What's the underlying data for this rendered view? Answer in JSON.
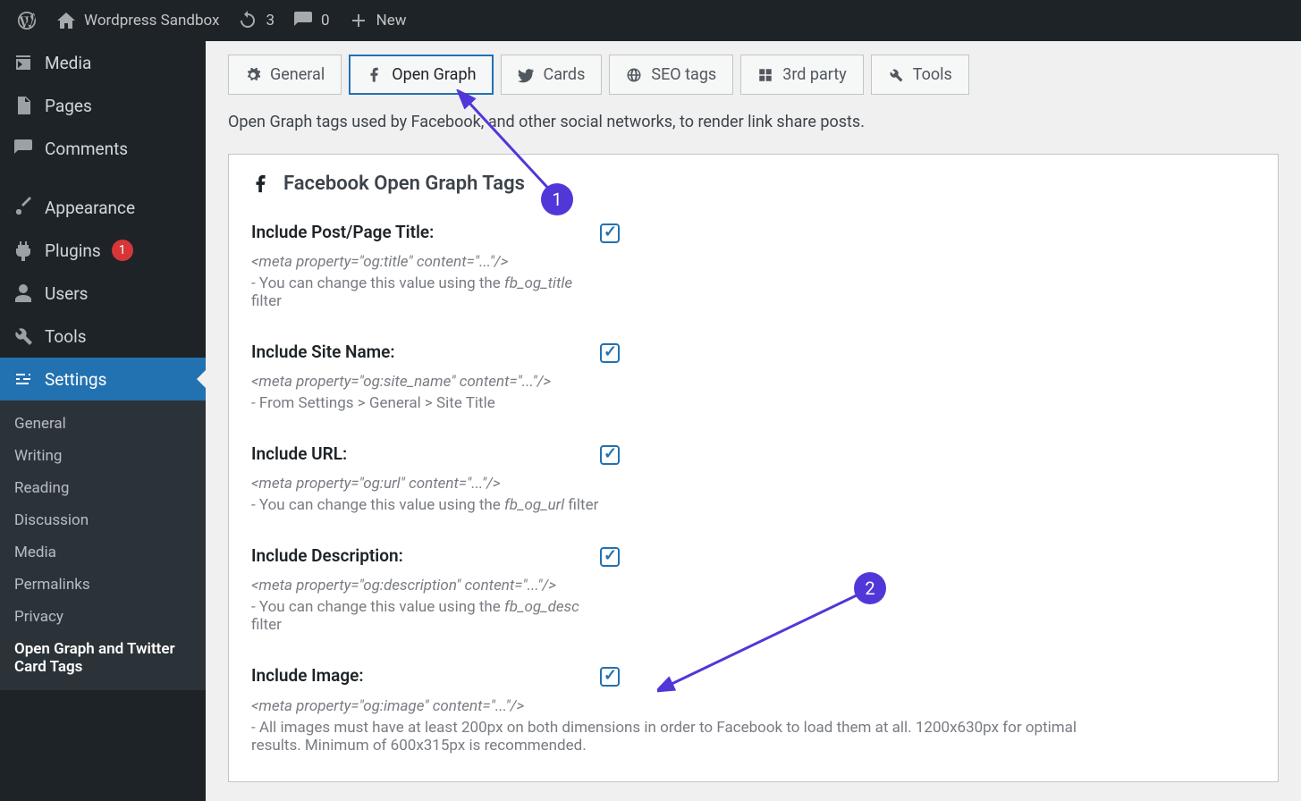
{
  "adminbar": {
    "site_name": "Wordpress Sandbox",
    "updates_count": "3",
    "comments_count": "0",
    "new_label": "New"
  },
  "sidebar": {
    "media": "Media",
    "pages": "Pages",
    "comments": "Comments",
    "appearance": "Appearance",
    "plugins": "Plugins",
    "plugins_badge": "1",
    "users": "Users",
    "tools": "Tools",
    "settings": "Settings",
    "sub": {
      "general": "General",
      "writing": "Writing",
      "reading": "Reading",
      "discussion": "Discussion",
      "media": "Media",
      "permalinks": "Permalinks",
      "privacy": "Privacy",
      "ogtags": "Open Graph and Twitter Card Tags"
    }
  },
  "tabs": {
    "general": "General",
    "open_graph": "Open Graph",
    "cards": "Cards",
    "seo": "SEO tags",
    "third_party": "3rd party",
    "tools": "Tools"
  },
  "intro": "Open Graph tags used by Facebook, and other social networks, to render link share posts.",
  "panel_title": "Facebook Open Graph Tags",
  "settings": {
    "title": {
      "label": "Include Post/Page Title:",
      "meta": "<meta property=\"og:title\" content=\"...\"/>",
      "note_prefix": "- You can change this value using the ",
      "note_filter": "fb_og_title",
      "note_suffix": " filter"
    },
    "sitename": {
      "label": "Include Site Name:",
      "meta": "<meta property=\"og:site_name\" content=\"...\"/>",
      "note": "- From Settings > General > Site Title"
    },
    "url": {
      "label": "Include URL:",
      "meta": "<meta property=\"og:url\" content=\"...\"/>",
      "note_prefix": "- You can change this value using the ",
      "note_filter": "fb_og_url",
      "note_suffix": " filter"
    },
    "desc": {
      "label": "Include Description:",
      "meta": "<meta property=\"og:description\" content=\"...\"/>",
      "note_prefix": "- You can change this value using the ",
      "note_filter": "fb_og_desc",
      "note_suffix": " filter"
    },
    "image": {
      "label": "Include Image:",
      "meta": "<meta property=\"og:image\" content=\"...\"/>",
      "note": "- All images must have at least 200px on both dimensions in order to Facebook to load them at all. 1200x630px for optimal results. Minimum of 600x315px is recommended."
    }
  },
  "anno": {
    "one": "1",
    "two": "2"
  }
}
